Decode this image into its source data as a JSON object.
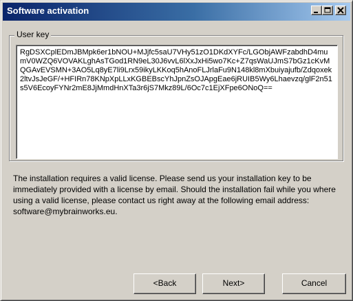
{
  "window": {
    "title": "Software activation"
  },
  "user_key": {
    "label": "User key",
    "value": "RgDSXCplEDmJBMpk6er1bNOU+MJjfc5saU7VHy51zO1DKdXYFc/LGObjAWFzabdhD4mumV0WZQ6VOVAKLghAsTGod1RN9eL30J6vvL6lXxJxHi5wo7Kc+Z7qsWaUJmS7bGz1cKvMQGAvEVSMN+3AO5Lq8yE7li9Lrx59ikyLKKoq5hAnoFLJrlaFu9N148kl8mXbuiyajufb/Zdqoxek2ltvJsJeGF/+HFIRn78KNpXpLLxKGBEBscYhJpnZsOJApgEae6jRUIB5Wy6Lhaevzq/glF2n51s5V6EcoyFYNr2mE8JjMmdHnXTa3r6jS7Mkz89L/6Oc7c1EjXFpe6ONoQ=="
  },
  "info_text": "The installation requires a valid license. Please send us your installation key to be immediately provided with a license by email. Should the installation fail while you where using a valid license, please contact us right away at the following email address: software@mybrainworks.eu.",
  "buttons": {
    "back": "<Back",
    "next": "Next>",
    "cancel": "Cancel"
  },
  "icons": {
    "minimize": "minimize-icon",
    "maximize": "maximize-icon",
    "close": "close-icon"
  },
  "colors": {
    "titlebar_start": "#0a246a",
    "titlebar_end": "#a6caf0",
    "face": "#d4d0c8"
  }
}
